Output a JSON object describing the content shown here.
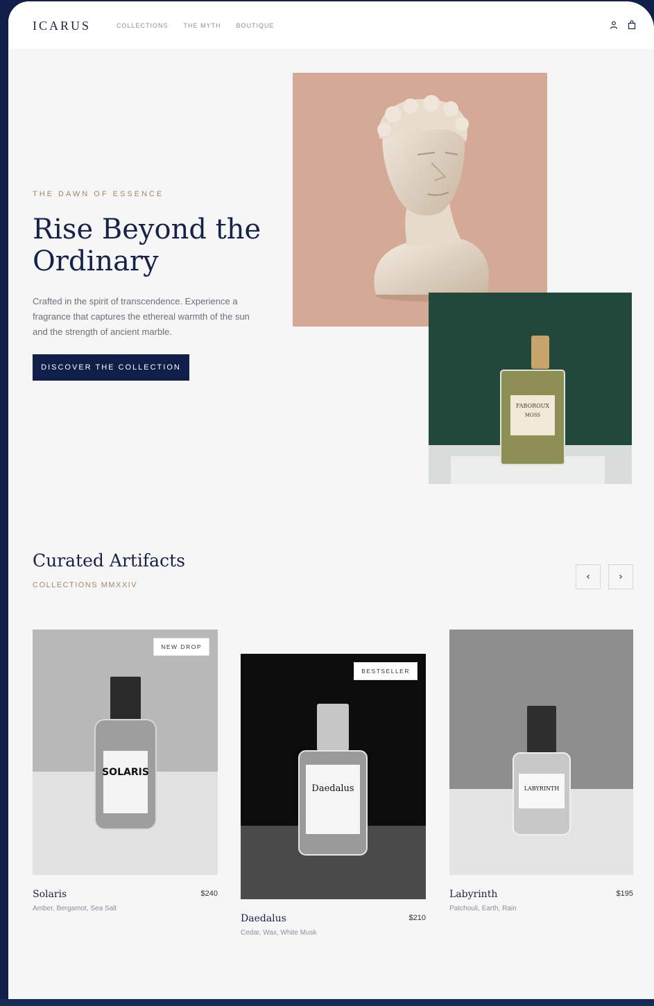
{
  "header": {
    "logo": "ICARUS",
    "nav": [
      "COLLECTIONS",
      "THE MYTH",
      "BOUTIQUE"
    ],
    "icons": [
      "user-icon",
      "shopping-bag-icon"
    ]
  },
  "hero": {
    "eyebrow": "THE DAWN OF ESSENCE",
    "title": "Rise Beyond the Ordinary",
    "description": "Crafted in the spirit of transcendence. Experience a fragrance that captures the ethereal warmth of the sun and the strength of ancient marble.",
    "cta_label": "DISCOVER THE COLLECTION",
    "bottle_label_line1": "FABOROUX",
    "bottle_label_line2": "MOSS"
  },
  "curated": {
    "title": "Curated Artifacts",
    "subtitle": "COLLECTIONS MMXXIV",
    "prev_icon": "chevron-left-icon",
    "next_icon": "chevron-right-icon",
    "products": [
      {
        "name": "Solaris",
        "price": "$240",
        "notes": "Amber, Bergamot, Sea Salt",
        "badge": "NEW DROP",
        "label": "SOLARIS"
      },
      {
        "name": "Daedalus",
        "price": "$210",
        "notes": "Cedar, Wax, White Musk",
        "badge": "BESTSELLER",
        "label": "Daedalus"
      },
      {
        "name": "Labyrinth",
        "price": "$195",
        "notes": "Patchouli, Earth, Rain",
        "badge": "",
        "label": "LABYRINTH"
      }
    ]
  },
  "colors": {
    "navy": "#0f1f4a",
    "gold": "#a48763",
    "page": "#f6f6f6",
    "terracotta": "#d4a995",
    "green": "#22473b"
  }
}
